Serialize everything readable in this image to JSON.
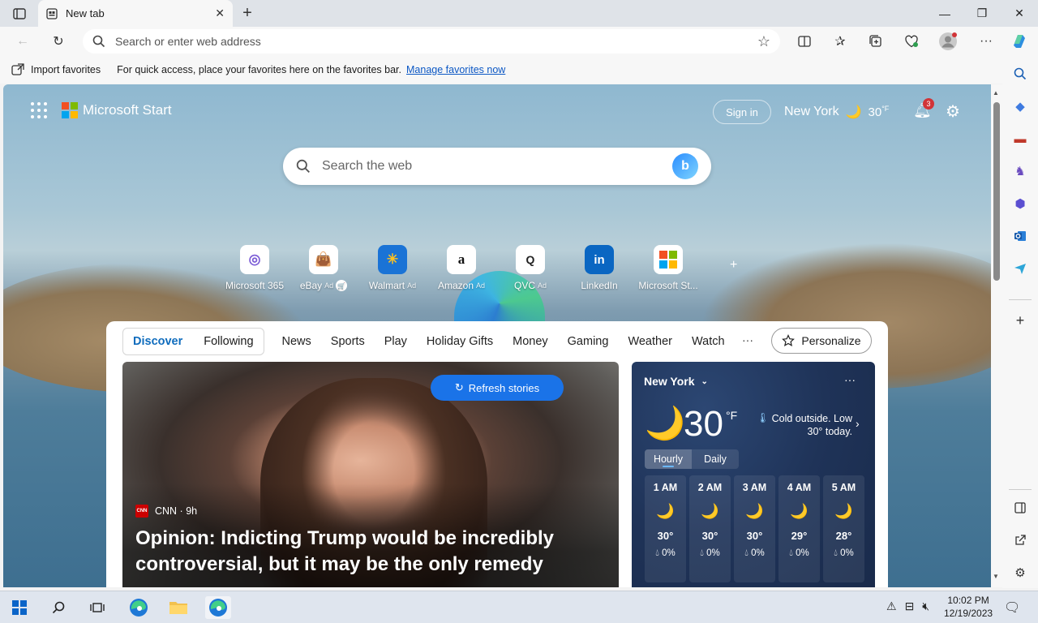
{
  "tab": {
    "title": "New tab"
  },
  "address": {
    "placeholder": "Search or enter web address"
  },
  "favorites_bar": {
    "import_label": "Import favorites",
    "message": "For quick access, place your favorites here on the favorites bar.",
    "manage_link": "Manage favorites now"
  },
  "start": {
    "brand": "Microsoft Start",
    "signin": "Sign in",
    "weather_city": "New York",
    "weather_temp": "30",
    "weather_unit": "°F",
    "notifications_count": "3",
    "search_placeholder": "Search the web"
  },
  "quick_links": [
    {
      "label": "Microsoft 365",
      "ad": ""
    },
    {
      "label": "eBay",
      "ad": "Ad"
    },
    {
      "label": "Walmart",
      "ad": "Ad"
    },
    {
      "label": "Amazon",
      "ad": "Ad"
    },
    {
      "label": "QVC",
      "ad": "Ad"
    },
    {
      "label": "LinkedIn",
      "ad": ""
    },
    {
      "label": "Microsoft St...",
      "ad": ""
    }
  ],
  "feed_nav": {
    "discover": "Discover",
    "following": "Following",
    "items": [
      "News",
      "Sports",
      "Play",
      "Holiday Gifts",
      "Money",
      "Gaming",
      "Weather",
      "Watch"
    ],
    "more": "···",
    "personalize": "Personalize"
  },
  "hero": {
    "refresh": "Refresh stories",
    "source": "CNN · 9h",
    "source_logo": "CNN",
    "headline": "Opinion: Indicting Trump would be incredibly controversial, but it may be the only remedy"
  },
  "weather_card": {
    "city": "New York",
    "temp": "30",
    "unit": "°F",
    "summary": "Cold outside. Low 30° today.",
    "tab_hourly": "Hourly",
    "tab_daily": "Daily",
    "hours": [
      {
        "time": "1 AM",
        "temp": "30°",
        "precip": "0%"
      },
      {
        "time": "2 AM",
        "temp": "30°",
        "precip": "0%"
      },
      {
        "time": "3 AM",
        "temp": "30°",
        "precip": "0%"
      },
      {
        "time": "4 AM",
        "temp": "29°",
        "precip": "0%"
      },
      {
        "time": "5 AM",
        "temp": "28°",
        "precip": "0%"
      }
    ]
  },
  "taskbar": {
    "time": "10:02 PM",
    "date": "12/19/2023"
  },
  "colors": {
    "accent": "#0f6cbd",
    "refresh_button": "#1a73e8",
    "badge": "#d13438",
    "weather_card_bg": "#1f3358"
  }
}
